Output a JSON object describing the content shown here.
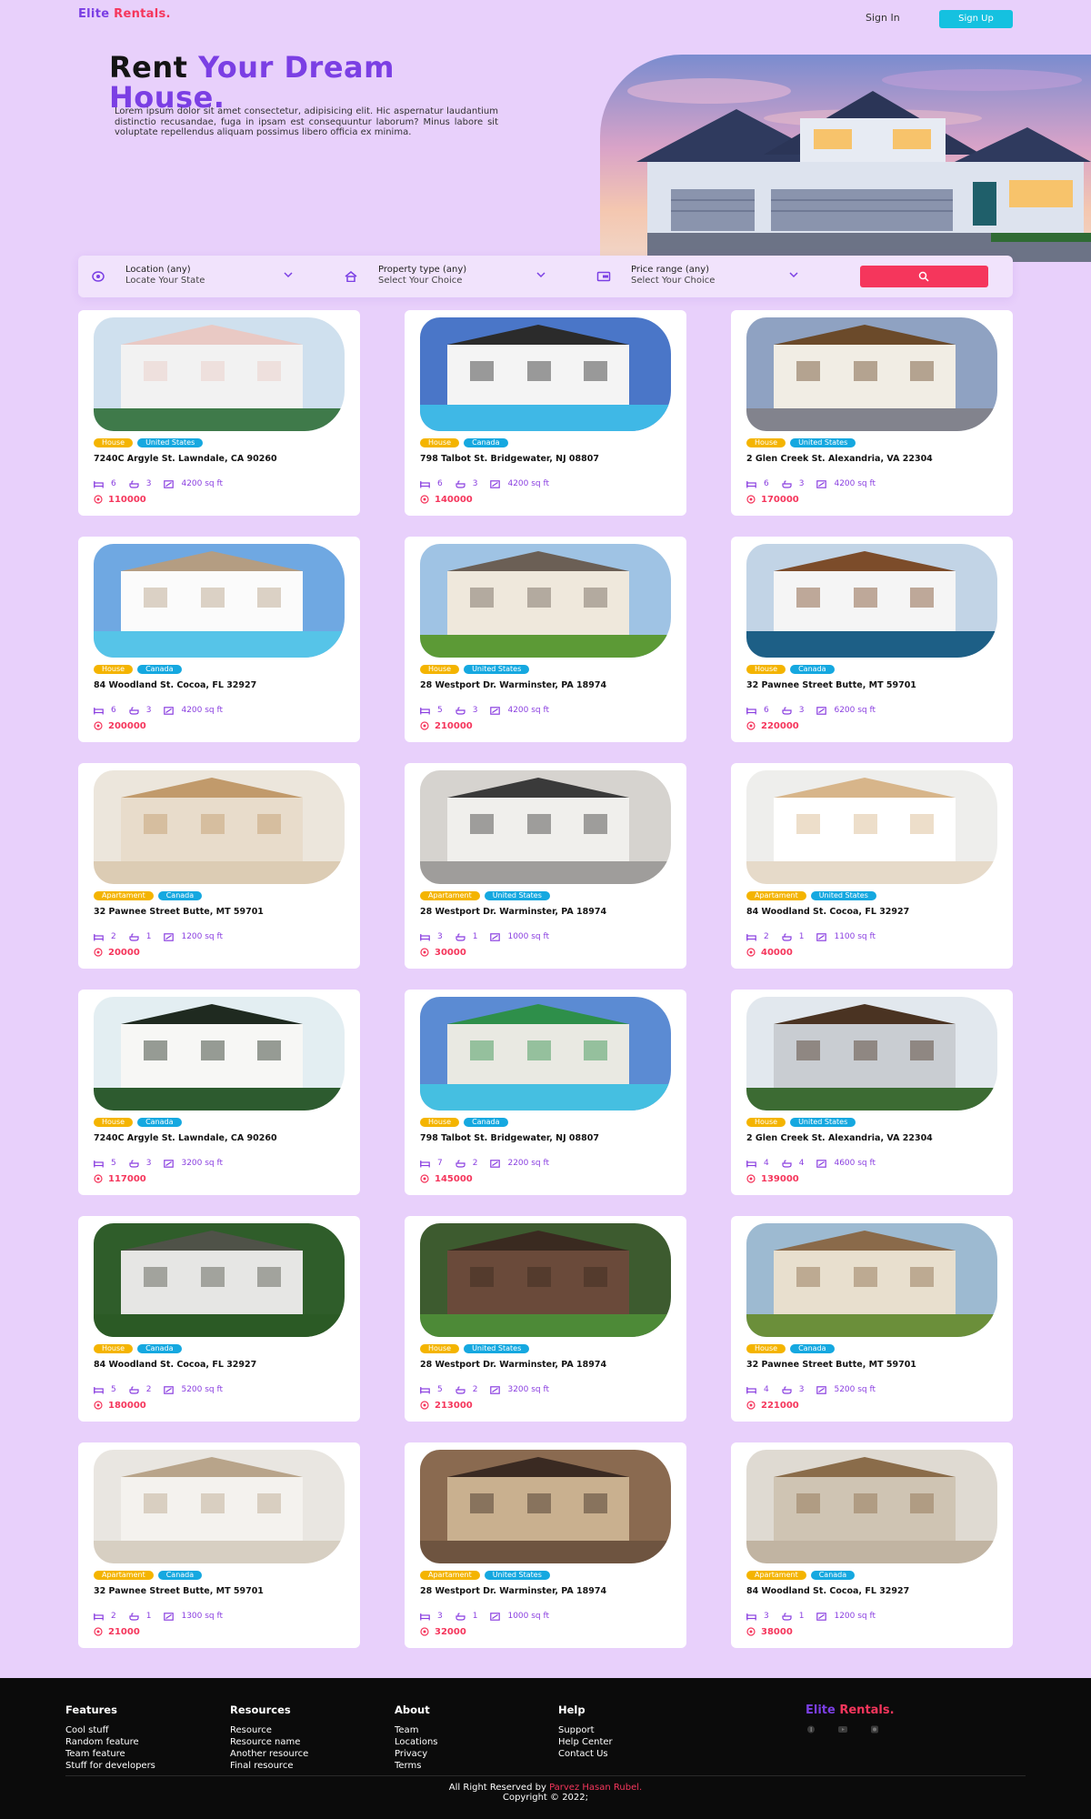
{
  "nav": {
    "logo_part1": "Elite",
    "logo_part2": "Rentals.",
    "signin": "Sign In",
    "signup": "Sign Up"
  },
  "hero": {
    "title_dark_1": "Rent",
    "title_purple": "Your Dream",
    "title_dark_2": "House.",
    "text": "Lorem ipsum dolor sit amet consectetur, adipisicing elit. Hic aspernatur laudantium distinctio recusandae, fuga in ipsam est consequuntur laborum? Minus labore sit voluptate repellendus aliquam possimus libero officia ex minima."
  },
  "search": {
    "location_label": "Location (any)",
    "location_hint": "Locate Your State",
    "property_label": "Property type (any)",
    "property_hint": "Select Your Choice",
    "price_label": "Price range (any)",
    "price_hint": "Select Your Choice"
  },
  "colors": {
    "background": "#e8d0fb",
    "accent_purple": "#7b3fe4",
    "accent_red": "#f5365c",
    "accent_cyan": "#15c1e0",
    "tag_type": "#f4b400",
    "tag_country": "#15a8e0"
  },
  "listings": [
    {
      "type": "House",
      "country": "United States",
      "address": "7240C Argyle St. Lawndale, CA 90260",
      "beds": "6",
      "baths": "3",
      "area": "4200 sq ft",
      "price": "110000"
    },
    {
      "type": "House",
      "country": "Canada",
      "address": "798 Talbot St. Bridgewater, NJ 08807",
      "beds": "6",
      "baths": "3",
      "area": "4200 sq ft",
      "price": "140000"
    },
    {
      "type": "House",
      "country": "United States",
      "address": "2 Glen Creek St. Alexandria, VA 22304",
      "beds": "6",
      "baths": "3",
      "area": "4200 sq ft",
      "price": "170000"
    },
    {
      "type": "House",
      "country": "Canada",
      "address": "84 Woodland St. Cocoa, FL 32927",
      "beds": "6",
      "baths": "3",
      "area": "4200 sq ft",
      "price": "200000"
    },
    {
      "type": "House",
      "country": "United States",
      "address": "28 Westport Dr. Warminster, PA 18974",
      "beds": "5",
      "baths": "3",
      "area": "4200 sq ft",
      "price": "210000"
    },
    {
      "type": "House",
      "country": "Canada",
      "address": "32 Pawnee Street Butte, MT 59701",
      "beds": "6",
      "baths": "3",
      "area": "6200 sq ft",
      "price": "220000"
    },
    {
      "type": "Apartament",
      "country": "Canada",
      "address": "32 Pawnee Street Butte, MT 59701",
      "beds": "2",
      "baths": "1",
      "area": "1200 sq ft",
      "price": "20000"
    },
    {
      "type": "Apartament",
      "country": "United States",
      "address": "28 Westport Dr. Warminster, PA 18974",
      "beds": "3",
      "baths": "1",
      "area": "1000 sq ft",
      "price": "30000"
    },
    {
      "type": "Apartament",
      "country": "United States",
      "address": "84 Woodland St. Cocoa, FL 32927",
      "beds": "2",
      "baths": "1",
      "area": "1100 sq ft",
      "price": "40000"
    },
    {
      "type": "House",
      "country": "Canada",
      "address": "7240C Argyle St. Lawndale, CA 90260",
      "beds": "5",
      "baths": "3",
      "area": "3200 sq ft",
      "price": "117000"
    },
    {
      "type": "House",
      "country": "Canada",
      "address": "798 Talbot St. Bridgewater, NJ 08807",
      "beds": "7",
      "baths": "2",
      "area": "2200 sq ft",
      "price": "145000"
    },
    {
      "type": "House",
      "country": "United States",
      "address": "2 Glen Creek St. Alexandria, VA 22304",
      "beds": "4",
      "baths": "4",
      "area": "4600 sq ft",
      "price": "139000"
    },
    {
      "type": "House",
      "country": "Canada",
      "address": "84 Woodland St. Cocoa, FL 32927",
      "beds": "5",
      "baths": "2",
      "area": "5200 sq ft",
      "price": "180000"
    },
    {
      "type": "House",
      "country": "United States",
      "address": "28 Westport Dr. Warminster, PA 18974",
      "beds": "5",
      "baths": "2",
      "area": "3200 sq ft",
      "price": "213000"
    },
    {
      "type": "House",
      "country": "Canada",
      "address": "32 Pawnee Street Butte, MT 59701",
      "beds": "4",
      "baths": "3",
      "area": "5200 sq ft",
      "price": "221000"
    },
    {
      "type": "Apartament",
      "country": "Canada",
      "address": "32 Pawnee Street Butte, MT 59701",
      "beds": "2",
      "baths": "1",
      "area": "1300 sq ft",
      "price": "21000"
    },
    {
      "type": "Apartament",
      "country": "United States",
      "address": "28 Westport Dr. Warminster, PA 18974",
      "beds": "3",
      "baths": "1",
      "area": "1000 sq ft",
      "price": "32000"
    },
    {
      "type": "Apartament",
      "country": "Canada",
      "address": "84 Woodland St. Cocoa, FL 32927",
      "beds": "3",
      "baths": "1",
      "area": "1200 sq ft",
      "price": "38000"
    }
  ],
  "footer": {
    "columns": [
      {
        "title": "Features",
        "links": [
          "Cool stuff",
          "Random feature",
          "Team feature",
          "Stuff for developers"
        ]
      },
      {
        "title": "Resources",
        "links": [
          "Resource",
          "Resource name",
          "Another resource",
          "Final resource"
        ]
      },
      {
        "title": "About",
        "links": [
          "Team",
          "Locations",
          "Privacy",
          "Terms"
        ]
      },
      {
        "title": "Help",
        "links": [
          "Support",
          "Help Center",
          "Contact Us"
        ]
      }
    ],
    "logo_part1": "Elite",
    "logo_part2": "Rentals.",
    "social_icons": [
      "facebook-icon",
      "youtube-icon",
      "instagram-icon"
    ],
    "copyright_prefix": "All Right Reserved by",
    "author": "Parvez Hasan Rubel.",
    "copyright_line2": "Copyright © 2022;"
  }
}
